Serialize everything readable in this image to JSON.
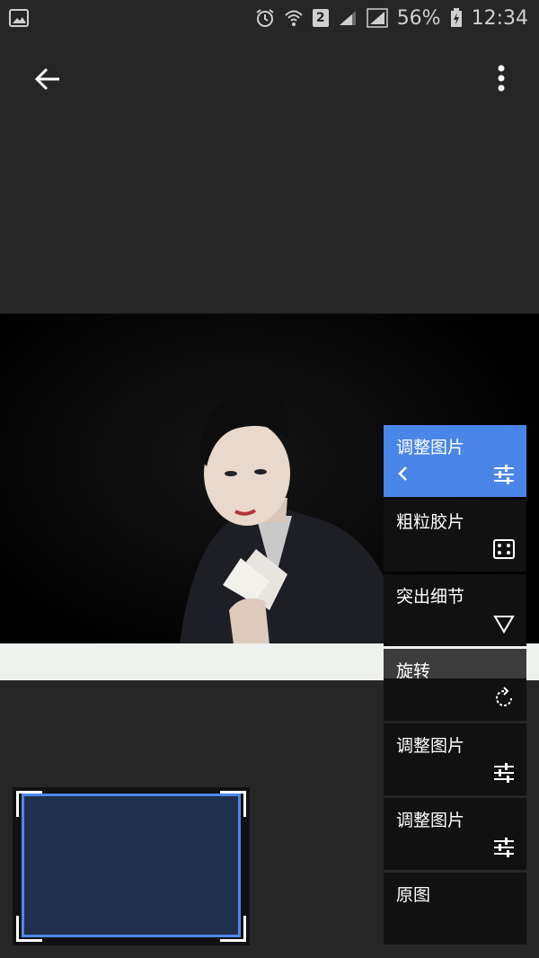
{
  "status": {
    "battery_percent": "56%",
    "time": "12:34",
    "sim_badge": "2"
  },
  "menu": {
    "items": [
      {
        "label": "调整图片",
        "icon": "sliders-icon"
      },
      {
        "label": "粗粒胶片",
        "icon": "dice-icon"
      },
      {
        "label": "突出细节",
        "icon": "triangle-down-icon"
      },
      {
        "label": "旋转",
        "icon": "rotate-icon"
      },
      {
        "label": "调整图片",
        "icon": "sliders-icon"
      },
      {
        "label": "调整图片",
        "icon": "sliders-icon"
      },
      {
        "label": "原图",
        "icon": ""
      }
    ]
  },
  "colors": {
    "background": "#262626",
    "accent": "#4a86e8",
    "menu_item_bg": "#111111"
  }
}
